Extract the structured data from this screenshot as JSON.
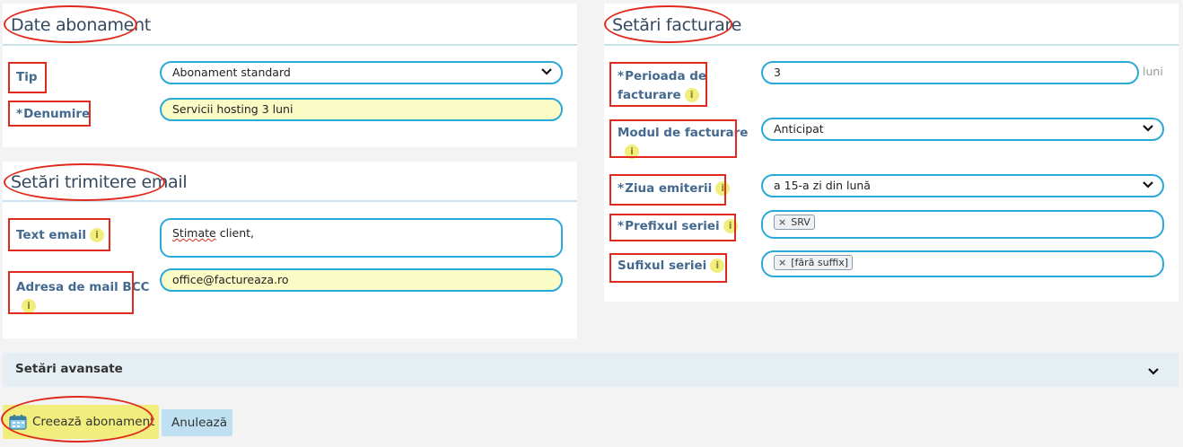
{
  "subscription_data": {
    "title": "Date abonament",
    "type_label": "Tip",
    "type_value": "Abonament standard",
    "name_label": "Denumire",
    "name_value": "Servicii hosting 3 luni"
  },
  "email_settings": {
    "title": "Setări trimitere email",
    "text_label": "Text email",
    "text_value_word1": "Stimate",
    "text_value_rest": " client,",
    "bcc_label": "Adresa de mail BCC",
    "bcc_value": "office@factureaza.ro"
  },
  "billing_settings": {
    "title": "Setări facturare",
    "period_label_line1": "Perioada de",
    "period_label_line2": "facturare",
    "period_value": "3",
    "period_unit": "luni",
    "mode_label_line1": "Modul de facturare",
    "mode_value": "Anticipat",
    "day_label": "Ziua emiterii",
    "day_value": "a 15-a zi din lună",
    "prefix_label": "Prefixul seriei",
    "prefix_tag": "SRV",
    "suffix_label": "Sufixul seriei",
    "suffix_tag": "[fără suffix]"
  },
  "advanced": {
    "label": "Setări avansate"
  },
  "actions": {
    "create_label": "Creează abonament",
    "cancel_label": "Anulează"
  },
  "common": {
    "required_mark": "*",
    "info_glyph": "i",
    "tag_remove_glyph": "×"
  },
  "colors": {
    "accent_border": "#2aa9d9",
    "highlight_yellow": "#f2ee7d",
    "annotation_red": "#e02a1e",
    "label_blue": "#44698f"
  },
  "icons": {
    "chevron": "chevron-down-icon",
    "info": "info-icon",
    "create": "calendar-icon"
  }
}
